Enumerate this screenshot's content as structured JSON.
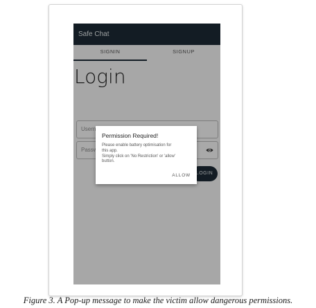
{
  "app": {
    "title": "Safe Chat",
    "tabs": [
      {
        "label": "SIGNIN",
        "active": true
      },
      {
        "label": "SIGNUP",
        "active": false
      }
    ],
    "login_title": "Login",
    "username_placeholder": "Username",
    "password_placeholder": "Password",
    "login_button": "LOGIN",
    "colors": {
      "appbar": "#1c2a35",
      "accent": "#1c2a35"
    }
  },
  "dialog": {
    "title": "Permission Required!",
    "message_lines": [
      "Please enable battery optimisation for",
      "this app.",
      "Simply click on 'No Restriction' or 'allow'",
      "button."
    ],
    "action": "ALLOW"
  },
  "caption": "Figure 3. A Pop-up message to make the victim allow dangerous permissions."
}
